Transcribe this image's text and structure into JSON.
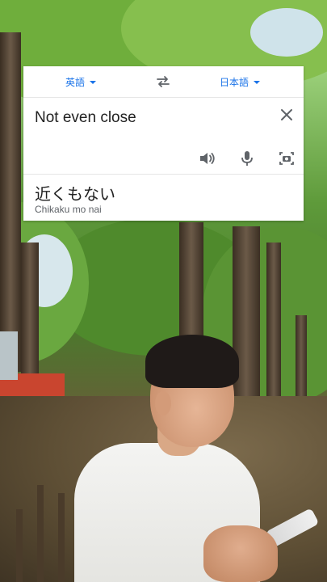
{
  "translator": {
    "source_language": "英語",
    "target_language": "日本語",
    "source_text": "Not even close",
    "translated_text": "近くもない",
    "romanization": "Chikaku mo nai",
    "icons": {
      "swap": "swap-languages-icon",
      "clear": "close-icon",
      "listen": "speaker-icon",
      "voice_input": "microphone-icon",
      "camera_input": "camera-icon"
    },
    "colors": {
      "accent": "#1a73e8",
      "text": "#222222",
      "secondary_text": "#5f6368"
    }
  },
  "background": {
    "description_icon": "forest-photo"
  }
}
